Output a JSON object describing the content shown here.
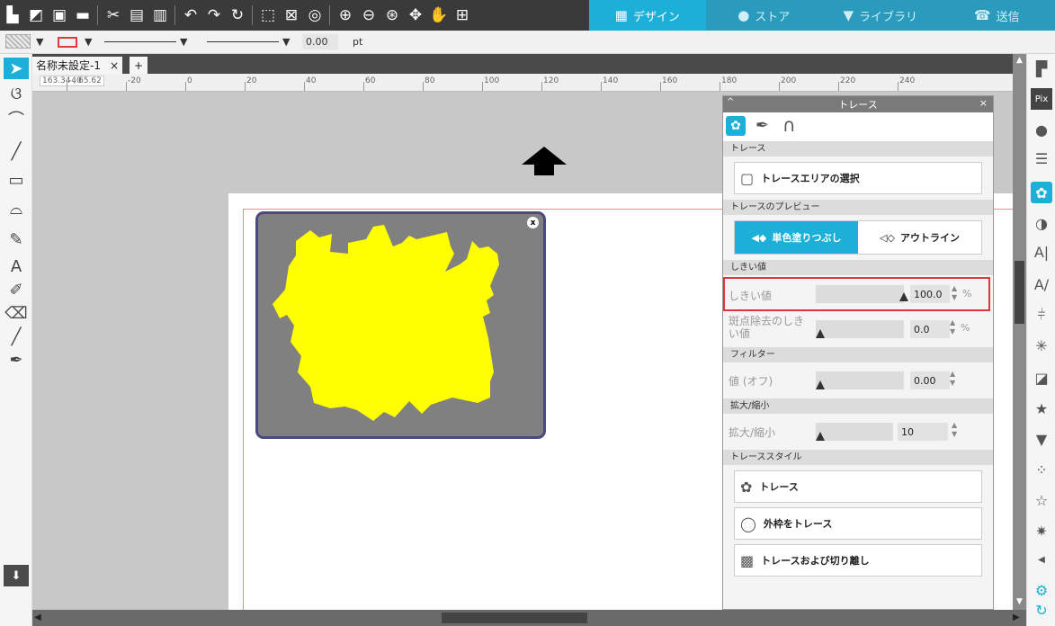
{
  "modes": [
    {
      "icon": "grid-icon",
      "label": "デザイン"
    },
    {
      "icon": "store-icon",
      "label": "ストア"
    },
    {
      "icon": "library-icon",
      "label": "ライブラリ"
    },
    {
      "icon": "send-icon",
      "label": "送信"
    }
  ],
  "propbar": {
    "line_width_value": "0.00",
    "unit": "pt"
  },
  "doc_tab": {
    "name": "名称未設定-1",
    "close": "×",
    "add": "+"
  },
  "ruler": {
    "coords": "163.34 , 65.62",
    "labels": [
      "-40",
      "-20",
      "0",
      "20",
      "40",
      "60",
      "80",
      "100",
      "120",
      "140",
      "160",
      "180",
      "200",
      "220",
      "240"
    ]
  },
  "trace_panel": {
    "title": "トレース",
    "trace_section": "トレース",
    "select_area_btn": "トレースエリアの選択",
    "preview_section": "トレースのプレビュー",
    "preview_fill": "単色塗りつぶし",
    "preview_outline": "アウトライン",
    "threshold_section": "しきい値",
    "threshold_label": "しきい値",
    "threshold_value": "100.0",
    "threshold_unit": "%",
    "threshold_fraction": 1.0,
    "speck_label": "斑点除去のしきい値",
    "speck_value": "0.0",
    "speck_unit": "%",
    "filter_section": "フィルター",
    "filter_label": "値 (オフ)",
    "filter_value": "0.00",
    "scale_section": "拡大/縮小",
    "scale_label": "拡大/縮小",
    "scale_value": "10",
    "style_section": "トレーススタイル",
    "style_trace": "トレース",
    "style_outer": "外枠をトレース",
    "style_detach": "トレースおよび切り離し"
  },
  "trace_object": {
    "close": "x",
    "fill_color": "#ffff00",
    "bg_color": "#808080"
  },
  "colors": {
    "accent": "#1cb0d8",
    "highlight_border": "#d9363e"
  }
}
